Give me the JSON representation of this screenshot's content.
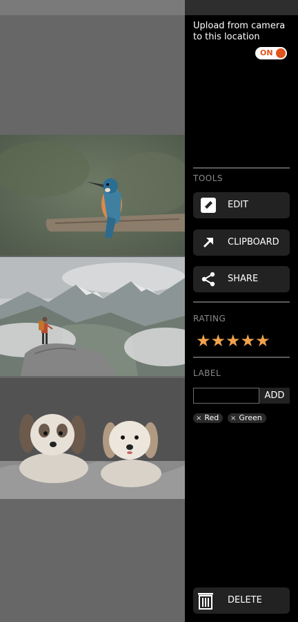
{
  "drawer": {
    "upload_text": "Upload from camera to this location",
    "toggle_label": "ON",
    "tools_title": "TOOLS",
    "tools": [
      {
        "label": "EDIT",
        "icon": "pencil-icon"
      },
      {
        "label": "CLIPBOARD",
        "icon": "arrow-up-right-icon"
      },
      {
        "label": "SHARE",
        "icon": "share-icon"
      }
    ],
    "rating_title": "RATING",
    "rating": {
      "value": 5,
      "max": 5,
      "stars_text": "★★★★★"
    },
    "label_title": "LABEL",
    "label_input_value": "",
    "add_label": "ADD",
    "chips": [
      {
        "text": "Red",
        "remove": "×"
      },
      {
        "text": "Green",
        "remove": "×"
      }
    ],
    "delete_label": "DELETE",
    "colors": {
      "accent": "#e0541d",
      "star": "#f0a24e"
    }
  },
  "gallery": {
    "photos": [
      {
        "name": "kingfisher-photo"
      },
      {
        "name": "mountain-hiker-photo"
      },
      {
        "name": "two-dogs-photo"
      }
    ]
  }
}
